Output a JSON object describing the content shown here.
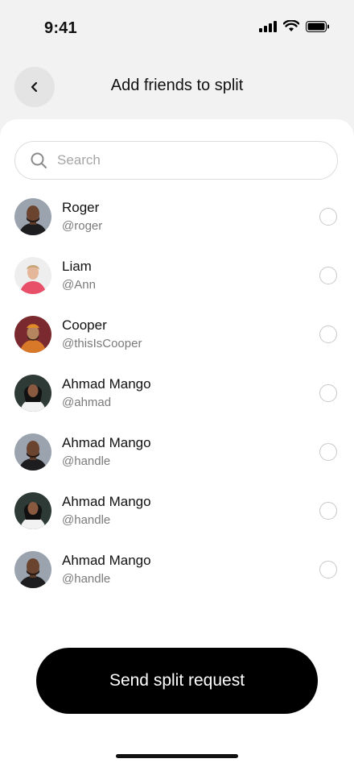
{
  "status_bar": {
    "time": "9:41"
  },
  "header": {
    "title": "Add friends to split",
    "back_icon": "chevron-left-icon"
  },
  "search": {
    "placeholder": "Search",
    "value": "",
    "icon": "search-icon"
  },
  "friends": [
    {
      "name": "Roger",
      "handle": "@roger",
      "selected": false
    },
    {
      "name": "Liam",
      "handle": "@Ann",
      "selected": false
    },
    {
      "name": "Cooper",
      "handle": "@thisIsCooper",
      "selected": false
    },
    {
      "name": "Ahmad Mango",
      "handle": "@ahmad",
      "selected": false
    },
    {
      "name": "Ahmad Mango",
      "handle": "@handle",
      "selected": false
    },
    {
      "name": "Ahmad Mango",
      "handle": "@handle",
      "selected": false
    },
    {
      "name": "Ahmad Mango",
      "handle": "@handle",
      "selected": false
    }
  ],
  "send_button": {
    "label": "Send split request"
  },
  "colors": {
    "background": "#f2f2f2",
    "sheet": "#ffffff",
    "primary_button": "#000000",
    "secondary_text": "#7a7a7a"
  }
}
